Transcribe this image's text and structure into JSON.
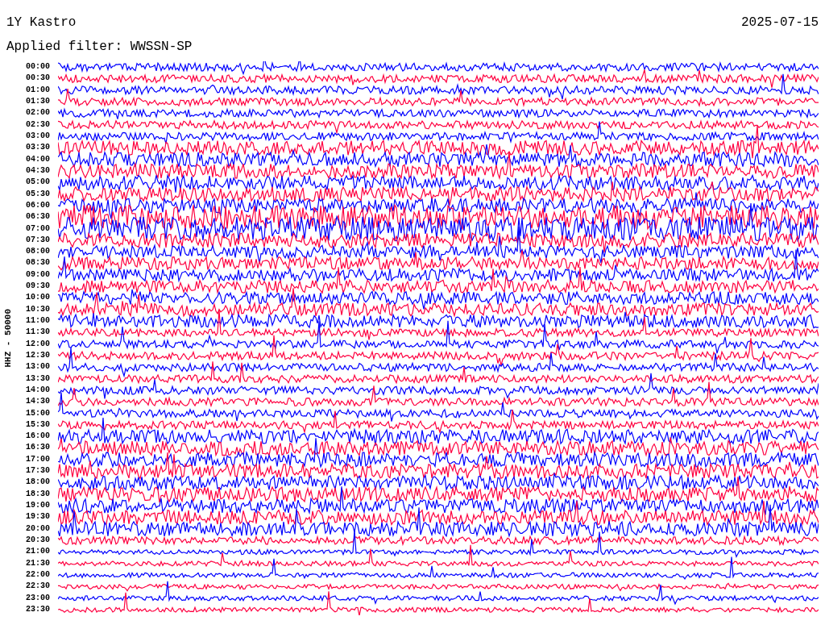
{
  "header": {
    "station": "1Y Kastro",
    "date": "2025-07-15",
    "filter": "Applied filter: WWSSN-SP"
  },
  "axis_label": "HHZ - 50000",
  "rows": [
    {
      "label": "00:00",
      "color": "#0000ff"
    },
    {
      "label": "00:30",
      "color": "#ff0040"
    },
    {
      "label": "01:00",
      "color": "#0000ff"
    },
    {
      "label": "01:30",
      "color": "#ff0040"
    },
    {
      "label": "02:00",
      "color": "#0000ff"
    },
    {
      "label": "02:30",
      "color": "#ff0040"
    },
    {
      "label": "03:00",
      "color": "#0000ff"
    },
    {
      "label": "03:30",
      "color": "#ff0040"
    },
    {
      "label": "04:00",
      "color": "#0000ff"
    },
    {
      "label": "04:30",
      "color": "#ff0040"
    },
    {
      "label": "05:00",
      "color": "#0000ff"
    },
    {
      "label": "05:30",
      "color": "#ff0040"
    },
    {
      "label": "06:00",
      "color": "#0000ff"
    },
    {
      "label": "06:30",
      "color": "#ff0040"
    },
    {
      "label": "07:00",
      "color": "#0000ff"
    },
    {
      "label": "07:30",
      "color": "#ff0040"
    },
    {
      "label": "08:00",
      "color": "#0000ff"
    },
    {
      "label": "08:30",
      "color": "#ff0040"
    },
    {
      "label": "09:00",
      "color": "#0000ff"
    },
    {
      "label": "09:30",
      "color": "#ff0040"
    },
    {
      "label": "10:00",
      "color": "#0000ff"
    },
    {
      "label": "10:30",
      "color": "#ff0040"
    },
    {
      "label": "11:00",
      "color": "#0000ff"
    },
    {
      "label": "11:30",
      "color": "#ff0040"
    },
    {
      "label": "12:00",
      "color": "#0000ff"
    },
    {
      "label": "12:30",
      "color": "#ff0040"
    },
    {
      "label": "13:00",
      "color": "#0000ff"
    },
    {
      "label": "13:30",
      "color": "#ff0040"
    },
    {
      "label": "14:00",
      "color": "#0000ff"
    },
    {
      "label": "14:30",
      "color": "#ff0040"
    },
    {
      "label": "15:00",
      "color": "#0000ff"
    },
    {
      "label": "15:30",
      "color": "#ff0040"
    },
    {
      "label": "16:00",
      "color": "#0000ff"
    },
    {
      "label": "16:30",
      "color": "#ff0040"
    },
    {
      "label": "17:00",
      "color": "#0000ff"
    },
    {
      "label": "17:30",
      "color": "#ff0040"
    },
    {
      "label": "18:00",
      "color": "#0000ff"
    },
    {
      "label": "18:30",
      "color": "#ff0040"
    },
    {
      "label": "19:00",
      "color": "#0000ff"
    },
    {
      "label": "19:30",
      "color": "#ff0040"
    },
    {
      "label": "20:00",
      "color": "#0000ff"
    },
    {
      "label": "20:30",
      "color": "#ff0040"
    },
    {
      "label": "21:00",
      "color": "#0000ff"
    },
    {
      "label": "21:30",
      "color": "#ff0040"
    },
    {
      "label": "22:00",
      "color": "#0000ff"
    },
    {
      "label": "22:30",
      "color": "#ff0040"
    },
    {
      "label": "23:00",
      "color": "#0000ff"
    },
    {
      "label": "23:30",
      "color": "#ff0040"
    }
  ]
}
